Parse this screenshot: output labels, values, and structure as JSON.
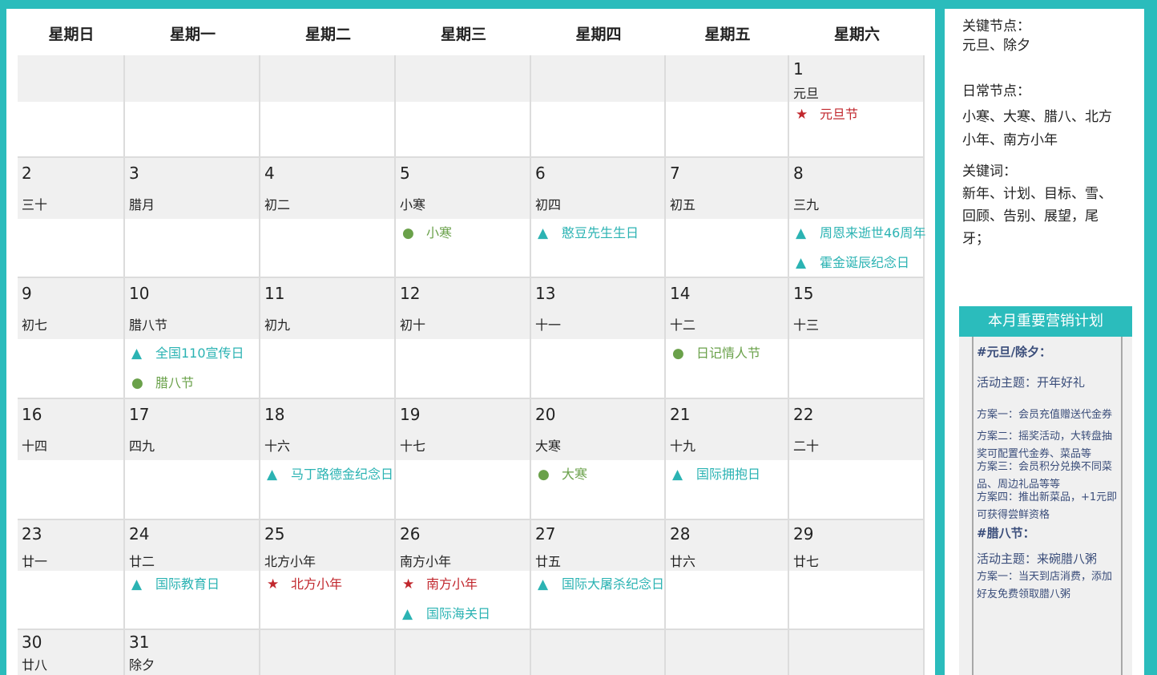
{
  "calendar": {
    "weekdays": [
      "星期日",
      "星期一",
      "星期二",
      "星期三",
      "星期四",
      "星期五",
      "星期六"
    ],
    "rows": [
      [
        {},
        {},
        {},
        {},
        {},
        {},
        {
          "day": "1",
          "lunar": "元旦",
          "events": [
            {
              "icon": "star",
              "text": "元旦节"
            }
          ]
        }
      ],
      [
        {
          "day": "2",
          "lunar": "三十",
          "events": []
        },
        {
          "day": "3",
          "lunar": "腊月",
          "events": []
        },
        {
          "day": "4",
          "lunar": "初二",
          "events": []
        },
        {
          "day": "5",
          "lunar": "小寒",
          "events": [
            {
              "icon": "circle",
              "text": "小寒"
            }
          ]
        },
        {
          "day": "6",
          "lunar": "初四",
          "events": [
            {
              "icon": "triangle",
              "text": "憨豆先生生日"
            }
          ]
        },
        {
          "day": "7",
          "lunar": "初五",
          "events": []
        },
        {
          "day": "8",
          "lunar": "三九",
          "events": [
            {
              "icon": "triangle",
              "text": "周恩来逝世46周年"
            },
            {
              "icon": "triangle",
              "text": "霍金诞辰纪念日"
            }
          ]
        }
      ],
      [
        {
          "day": "9",
          "lunar": "初七",
          "events": []
        },
        {
          "day": "10",
          "lunar": "腊八节",
          "events": [
            {
              "icon": "triangle",
              "text": "全国110宣传日"
            },
            {
              "icon": "circle",
              "text": "腊八节"
            }
          ]
        },
        {
          "day": "11",
          "lunar": "初九",
          "events": []
        },
        {
          "day": "12",
          "lunar": "初十",
          "events": []
        },
        {
          "day": "13",
          "lunar": "十一",
          "events": []
        },
        {
          "day": "14",
          "lunar": "十二",
          "events": [
            {
              "icon": "circle",
              "text": "日记情人节"
            }
          ]
        },
        {
          "day": "15",
          "lunar": "十三",
          "events": []
        }
      ],
      [
        {
          "day": "16",
          "lunar": "十四",
          "events": []
        },
        {
          "day": "17",
          "lunar": "四九",
          "events": []
        },
        {
          "day": "18",
          "lunar": "十六",
          "events": [
            {
              "icon": "triangle",
              "text": "马丁路德金纪念日"
            }
          ]
        },
        {
          "day": "19",
          "lunar": "十七",
          "events": []
        },
        {
          "day": "20",
          "lunar": "大寒",
          "events": [
            {
              "icon": "circle",
              "text": "大寒"
            }
          ]
        },
        {
          "day": "21",
          "lunar": "十九",
          "events": [
            {
              "icon": "triangle",
              "text": "国际拥抱日"
            }
          ]
        },
        {
          "day": "22",
          "lunar": "二十",
          "events": []
        }
      ],
      [
        {
          "day": "23",
          "lunar": "廿一",
          "events": []
        },
        {
          "day": "24",
          "lunar": "廿二",
          "events": [
            {
              "icon": "triangle",
              "text": "国际教育日"
            }
          ]
        },
        {
          "day": "25",
          "lunar": "北方小年",
          "events": [
            {
              "icon": "star",
              "text": "北方小年"
            }
          ]
        },
        {
          "day": "26",
          "lunar": "南方小年",
          "events": [
            {
              "icon": "star",
              "text": "南方小年"
            },
            {
              "icon": "triangle",
              "text": "国际海关日"
            }
          ]
        },
        {
          "day": "27",
          "lunar": "廿五",
          "events": [
            {
              "icon": "triangle",
              "text": "国际大屠杀纪念日"
            }
          ]
        },
        {
          "day": "28",
          "lunar": "廿六",
          "events": []
        },
        {
          "day": "29",
          "lunar": "廿七",
          "events": []
        }
      ],
      [
        {
          "day": "30",
          "lunar": "廿八",
          "events": []
        },
        {
          "day": "31",
          "lunar": "除夕",
          "events": []
        },
        {},
        {},
        {},
        {},
        {}
      ]
    ]
  },
  "icons": {
    "star": {
      "glyph": "★",
      "name": "star-icon",
      "color": "#c1272d"
    },
    "triangle": {
      "glyph": "▲",
      "name": "triangle-icon",
      "color": "#2bb3b3"
    },
    "circle": {
      "glyph": "●",
      "name": "circle-icon",
      "color": "#6aa14a"
    }
  },
  "sidebar": {
    "key_nodes_label": "关键节点：",
    "key_nodes_value": "元旦、除夕",
    "daily_nodes_label": "日常节点：",
    "daily_nodes_line1": "小寒、大寒、腊八、北方",
    "daily_nodes_line2": "小年、南方小年",
    "keywords_label": "关键词：",
    "keywords_line1": "新年、计划、目标、雪、",
    "keywords_line2": "回顾、告别、展望，尾",
    "keywords_line3": "牙；"
  },
  "plan": {
    "title": "本月重要营销计划",
    "h1": "#元旦/除夕：",
    "theme1": "活动主题：开年好礼",
    "p1": "方案一：会员充值赠送代金券",
    "p2a": "方案二：摇奖活动，大转盘抽",
    "p2b": "奖可配置代金券、菜品等",
    "p3a": "方案三：会员积分兑换不同菜",
    "p3b": "品、周边礼品等等",
    "p4a": "方案四：推出新菜品，+1元即",
    "p4b": "可获得尝鲜资格",
    "h2": "#腊八节：",
    "theme2": "活动主题：来碗腊八粥",
    "p5a": "方案一：当天到店消费，添加",
    "p5b": "好友免费领取腊八粥"
  },
  "colors": {
    "frame": "#2bbcbc",
    "accent_teal": "#2bb3b3",
    "accent_green": "#6aa14a",
    "accent_red": "#c1272d",
    "plan_text": "#3a4d7a"
  }
}
